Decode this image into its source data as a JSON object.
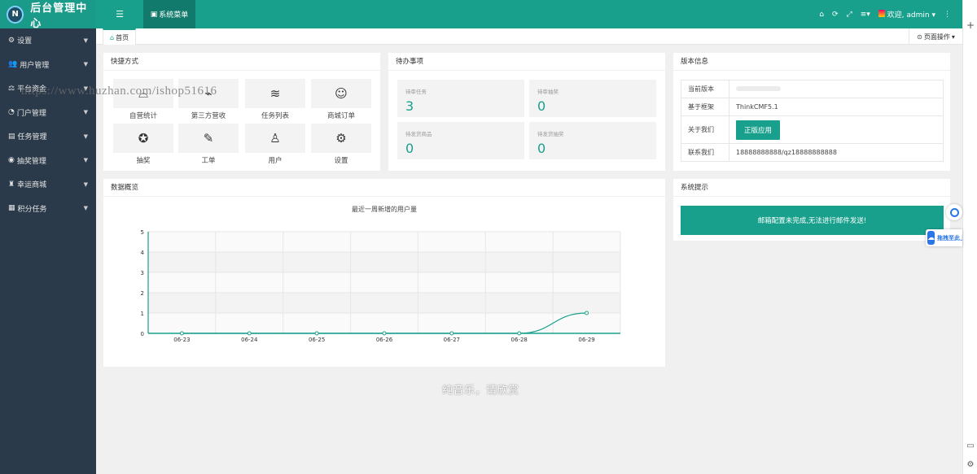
{
  "header": {
    "brand": "后台管理中心",
    "brand_logo": "N",
    "menu_toggle_icon": "☰",
    "system_menu": "系统菜单",
    "welcome": "欢迎, admin",
    "icons": [
      "home-icon",
      "refresh-icon",
      "fullscreen-icon",
      "list-icon"
    ],
    "accent_color": "#18a08d"
  },
  "sidebar": {
    "items": [
      {
        "icon": "⚙",
        "label": "设置"
      },
      {
        "icon": "👥",
        "label": "用户管理"
      },
      {
        "icon": "⚖",
        "label": "平台资金"
      },
      {
        "icon": "◔",
        "label": "门户管理"
      },
      {
        "icon": "▤",
        "label": "任务管理"
      },
      {
        "icon": "◉",
        "label": "抽奖管理"
      },
      {
        "icon": "♜",
        "label": "幸运商城"
      },
      {
        "icon": "▦",
        "label": "积分任务"
      }
    ]
  },
  "watermark": "https://www.huzhan.com/ishop51616",
  "tabs": {
    "home": "首页",
    "page_ops": "页面操作"
  },
  "quick": {
    "title": "快捷方式",
    "items": [
      {
        "icon": "⌓",
        "label": "自营统计"
      },
      {
        "icon": "⌁",
        "label": "第三方营收"
      },
      {
        "icon": "≋",
        "label": "任务列表"
      },
      {
        "icon": "☺",
        "label": "商城订单"
      },
      {
        "icon": "✪",
        "label": "抽奖"
      },
      {
        "icon": "✎",
        "label": "工单"
      },
      {
        "icon": "♙",
        "label": "用户"
      },
      {
        "icon": "⚙",
        "label": "设置"
      }
    ]
  },
  "todo": {
    "title": "待办事项",
    "items": [
      {
        "label": "待审任务",
        "value": "3"
      },
      {
        "label": "待审抽奖",
        "value": "0"
      },
      {
        "label": "待发货商品",
        "value": "0"
      },
      {
        "label": "待发货抽奖",
        "value": "0"
      }
    ]
  },
  "version": {
    "title": "版本信息",
    "rows": [
      {
        "key": "当前版本",
        "value": ""
      },
      {
        "key": "基于框架",
        "value": "ThinkCMF5.1"
      },
      {
        "key": "关于我们",
        "button": "正版应用"
      },
      {
        "key": "联系我们",
        "value": "18888888888/qz18888888888"
      }
    ]
  },
  "overview": {
    "title": "数据概览"
  },
  "notice": {
    "title": "系统提示",
    "message": "邮箱配置未完成,无法进行邮件发送!"
  },
  "chart_data": {
    "type": "line",
    "title": "最近一周新增的用户量",
    "x": [
      "06-23",
      "06-24",
      "06-25",
      "06-26",
      "06-27",
      "06-28",
      "06-29"
    ],
    "series": [
      {
        "values": [
          0,
          0,
          0,
          0,
          0,
          0,
          1
        ],
        "color": "#18a08d"
      }
    ],
    "ylim": [
      0,
      5
    ],
    "yticks": [
      "0",
      "1",
      "2",
      "3",
      "4",
      "5"
    ],
    "grid": true
  },
  "overlay_text": "纯音乐，请欣赏",
  "float_widget": "拖拽至此上"
}
